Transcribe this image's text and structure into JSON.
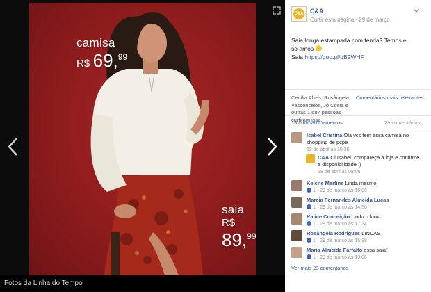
{
  "photo": {
    "shirt_label": "camisa",
    "shirt_currency": "R$",
    "shirt_price": "69,",
    "shirt_cents": "99",
    "skirt_label": "saia",
    "skirt_currency": "R$",
    "skirt_price": "89,",
    "skirt_cents": "99",
    "background_color": "#8e1c1d"
  },
  "viewer": {
    "caption": "Fotos da Linha do Tempo",
    "prev_icon": "chevron-left-icon",
    "next_icon": "chevron-right-icon",
    "fullscreen_icon": "expand-icon"
  },
  "post": {
    "page_name": "C&A",
    "logo_text": "C&A",
    "subtitle": "Curtir esta página · 29 de março",
    "text": "Saia longa estampada com fenda? Temos e",
    "text2": "só amos ",
    "text3": "Saia ",
    "link": "https://goo.gl/qB2WHF",
    "accent_color": "#365899"
  },
  "reactions": {
    "likers": "Cecília Alves, Rosângela Vasconcelos, Jô Costa e outras 1.687 pessoas curtiram isso.",
    "relevance": "Comentários mais relevantes"
  },
  "counts": {
    "shares": "18 compartilhamentos",
    "comments": "29 comentários"
  },
  "comments": [
    {
      "name": "Isabel Cristina",
      "text": "Ola vcs tem essa camisa no shopping de pcpe",
      "meta": "12 de abril às 10:30",
      "likes": ""
    },
    {
      "name": "Kelcne Martins",
      "text": "Linda mesmo",
      "meta": "29 de março às 16:06",
      "likes": "1"
    },
    {
      "name": "Marcia Fernandes Almeida Lucas",
      "text": "",
      "meta": "29 de março às 14:50",
      "likes": "1"
    },
    {
      "name": "Kalice Conceição",
      "text": "Lindo o look",
      "meta": "29 de março às 17:34",
      "likes": "1"
    },
    {
      "name": "Rosângela Rodrigues",
      "text": "LINDAS",
      "meta": "29 de março às 15:38",
      "likes": "1"
    },
    {
      "name": "Maria Almeida Farfalto",
      "text": "essa saia!",
      "meta": "29 de março às 13:06",
      "likes": "1"
    }
  ],
  "reply": {
    "name": "C&A",
    "text": "Oi Isabel, compareça à loja e confirme a disponibilidade :)",
    "meta": "18 de abril às 08:06"
  },
  "more_comments": "Ver mais 23 comentários"
}
